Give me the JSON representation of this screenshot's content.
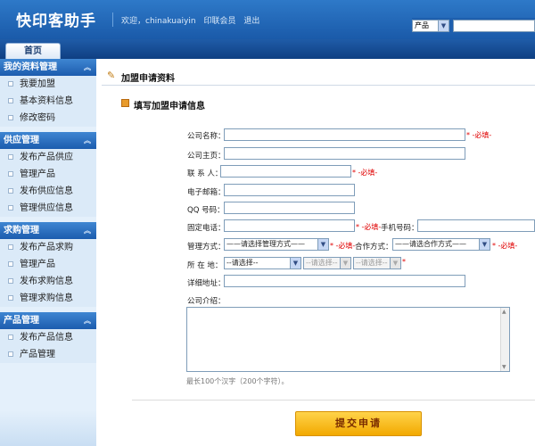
{
  "header": {
    "title": "快印客助手",
    "welcome": "欢迎，chinakuaiyin",
    "link_member": "印联会员",
    "link_logout": "退出",
    "search_select": "产品"
  },
  "nav": {
    "home_tab": "首页"
  },
  "sidebar": {
    "groups": [
      {
        "title": "我的资料管理",
        "items": [
          "我要加盟",
          "基本资料信息",
          "修改密码"
        ]
      },
      {
        "title": "供应管理",
        "items": [
          "发布产品供应",
          "管理产品",
          "发布供应信息",
          "管理供应信息"
        ]
      },
      {
        "title": "求购管理",
        "items": [
          "发布产品求购",
          "管理产品",
          "发布求购信息",
          "管理求购信息"
        ]
      },
      {
        "title": "产品管理",
        "items": [
          "发布产品信息",
          "产品管理"
        ]
      }
    ]
  },
  "main": {
    "page_title": "加盟申请资料",
    "section_title": "填写加盟申请信息",
    "labels": {
      "company_name": "公司名称：",
      "homepage": "公司主页：",
      "contact": "联 系 人：",
      "email": "电子邮箱：",
      "qq": "QQ 号码：",
      "phone": "固定电话：",
      "mobile": "手机号码：",
      "management": "管理方式：",
      "cooperation": "合作方式：",
      "location": "所 在 地：",
      "address": "详细地址：",
      "intro": "公司介绍："
    },
    "required": "* -必填-",
    "required_asterisk": "*",
    "selects": {
      "management": "——请选择管理方式——",
      "cooperation": "——请选合作方式——",
      "province": "--请选择--",
      "city": "--请选择--",
      "district": "--请选择--"
    },
    "hint": "最长100个汉字（200个字符）。",
    "submit": "提交申请"
  },
  "colors": {
    "header_blue": "#1a5aa9",
    "required_red": "#e00000",
    "submit_yellow": "#f2a900"
  }
}
